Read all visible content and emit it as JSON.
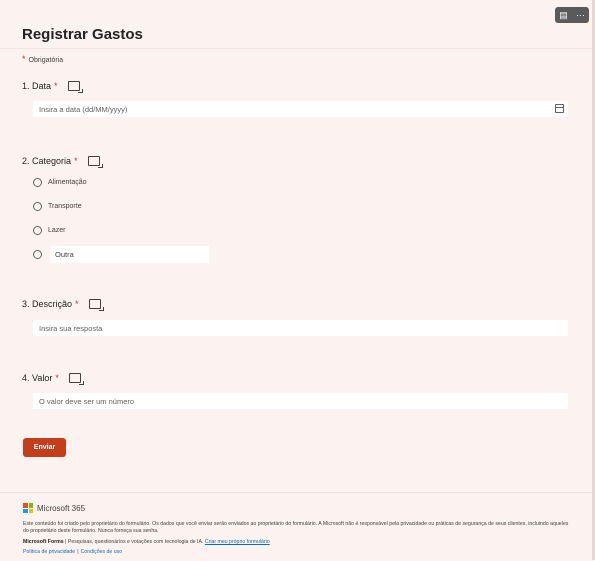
{
  "form": {
    "title": "Registrar Gastos",
    "required_note": "Obrigatória",
    "required_star": "*",
    "top_actions": {
      "immersive_icon": "immersive-reader-icon",
      "more": "···"
    }
  },
  "questions": [
    {
      "number": "1.",
      "label": "Data",
      "placeholder": "Insira a data (dd/MM/yyyy)"
    },
    {
      "number": "2.",
      "label": "Categoria",
      "options": [
        "Alimentação",
        "Transporte",
        "Lazer"
      ],
      "other_label": "Outra"
    },
    {
      "number": "3.",
      "label": "Descrição",
      "placeholder": "Insira sua resposta"
    },
    {
      "number": "4.",
      "label": "Valor",
      "placeholder": "O valor deve ser um número"
    }
  ],
  "submit_label": "Enviar",
  "footer": {
    "brand": "Microsoft 365",
    "disclaimer": "Este conteúdo foi criado pelo proprietário do formulário. Os dados que você enviar serão enviados ao proprietário do formulário. A Microsoft não é responsável pela privacidade ou práticas de segurança de seus clientes, incluindo aqueles do proprietário deste formulário. Nunca forneça sua senha.",
    "forms_brand": "Microsoft Forms",
    "forms_tagline": " | Pesquisas, questionários e votações com tecnologia de IA. ",
    "create_link": "Criar meu próprio formulário",
    "privacy_link": "Política de privacidade",
    "links_sep": "|",
    "terms_link": "Condições de uso"
  },
  "colors": {
    "accent": "#c43e1c",
    "required": "#c4314b",
    "background": "#fcf2ef",
    "link": "#0f6cbd"
  }
}
